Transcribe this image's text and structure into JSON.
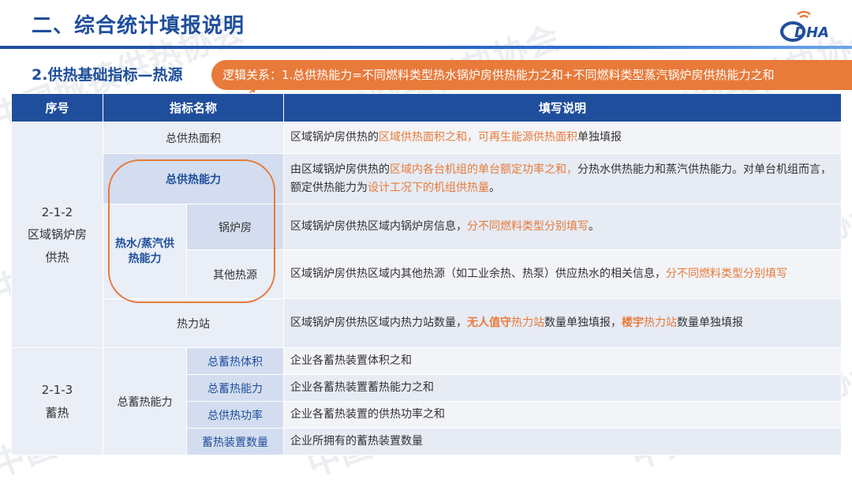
{
  "header": {
    "title": "二、综合统计填报说明",
    "logo_text": "DHA"
  },
  "section": {
    "title": "2.供热基础指标—热源",
    "logic": "逻辑关系：1.总供热能力=不同燃料类型热水锅炉房供热能力之和+不同燃料类型蒸汽锅炉房供热能力之和"
  },
  "table": {
    "headers": [
      "序号",
      "指标名称",
      "填写说明"
    ],
    "group1": {
      "num_line1": "2-1-2",
      "num_line2": "区域锅炉房",
      "num_line3": "供热",
      "rows": {
        "area": {
          "name": "总供热面积",
          "desc_a": "区域锅炉房供热的",
          "desc_b": "区域供热面积之和，可再生能源供热面积",
          "desc_c": "单独填报"
        },
        "capacity": {
          "name": "总供热能力",
          "desc_a": "由区域锅炉房供热的",
          "desc_b": "区域内各台机组的单台额定功率之和，",
          "desc_c": "分热水供热能力和蒸汽供热能力。对单台机组而言，额定供热能力为",
          "desc_d": "设计工况下的机组供热量",
          "desc_e": "。"
        },
        "hotwater_label": "热水/蒸汽供热能力",
        "boiler": {
          "name": "锅炉房",
          "desc_a": "区域锅炉房供热区域内锅炉房信息，",
          "desc_b": "分不同燃料类型分别填写",
          "desc_c": "。"
        },
        "other": {
          "name": "其他热源",
          "desc_a": "区域锅炉房供热区域内其他热源（如工业余热、热泵）供应热水的相关信息，",
          "desc_b": "分不同燃料类型分别填写"
        },
        "station": {
          "name": "热力站",
          "desc_a": "区域锅炉房供热区域内热力站数量，",
          "desc_b": "无人值守",
          "desc_c": "热力站",
          "desc_d": "数量单独填报，",
          "desc_e": "楼宇",
          "desc_f": "热力站",
          "desc_g": "数量单独填报"
        }
      }
    },
    "group2": {
      "num_line1": "2-1-3",
      "num_line2": "蓄热",
      "name": "总蓄热能力",
      "rows": [
        {
          "name": "总蓄热体积",
          "desc": "企业各蓄热装置体积之和"
        },
        {
          "name": "总蓄热能力",
          "desc": "企业各蓄热装置蓄热能力之和"
        },
        {
          "name": "总供热功率",
          "desc": "企业各蓄热装置的供热功率之和"
        },
        {
          "name": "蓄热装置数量",
          "desc": "企业所拥有的蓄热装置数量"
        }
      ]
    }
  },
  "watermark": "中国城镇供热协会",
  "colors": {
    "primary": "#1f4e9c",
    "accent": "#e87a3a"
  }
}
